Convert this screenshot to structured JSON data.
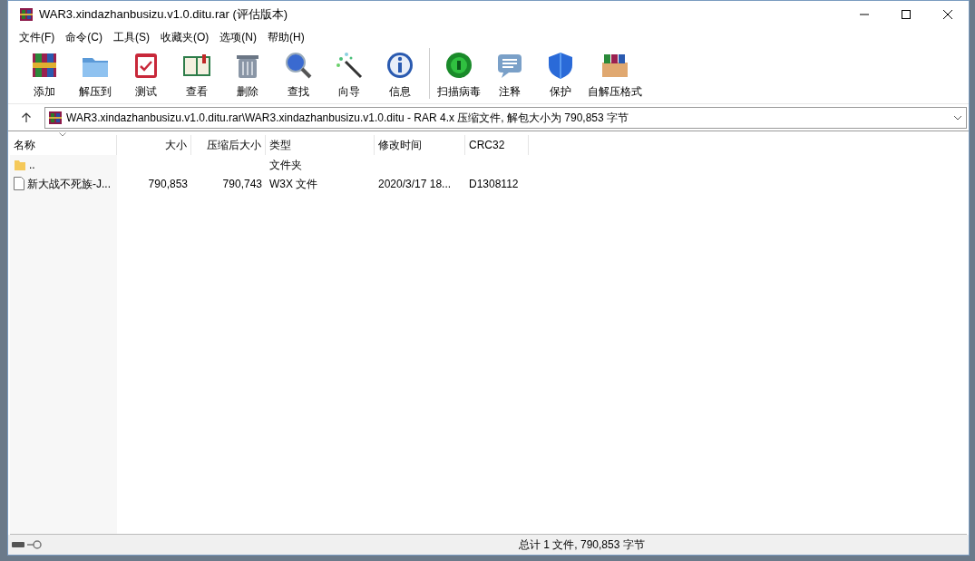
{
  "window": {
    "title": "WAR3.xindazhanbusizu.v1.0.ditu.rar (评估版本)"
  },
  "menu": [
    "文件(F)",
    "命令(C)",
    "工具(S)",
    "收藏夹(O)",
    "选项(N)",
    "帮助(H)"
  ],
  "toolbar": {
    "groups": [
      [
        {
          "kind": "add",
          "label": "添加"
        },
        {
          "kind": "extract",
          "label": "解压到"
        },
        {
          "kind": "test",
          "label": "测试"
        },
        {
          "kind": "view",
          "label": "查看"
        },
        {
          "kind": "delete",
          "label": "删除"
        },
        {
          "kind": "find",
          "label": "查找"
        },
        {
          "kind": "wizard",
          "label": "向导"
        },
        {
          "kind": "info",
          "label": "信息"
        }
      ],
      [
        {
          "kind": "scan",
          "label": "扫描病毒"
        },
        {
          "kind": "comment",
          "label": "注释"
        },
        {
          "kind": "protect",
          "label": "保护"
        },
        {
          "kind": "sfx",
          "label": "自解压格式"
        }
      ]
    ]
  },
  "address": {
    "path": "WAR3.xindazhanbusizu.v1.0.ditu.rar\\WAR3.xindazhanbusizu.v1.0.ditu - RAR 4.x 压缩文件, 解包大小为 790,853 字节"
  },
  "table": {
    "columns": [
      "名称",
      "大小",
      "压缩后大小",
      "类型",
      "修改时间",
      "CRC32"
    ],
    "rows": [
      {
        "kind": "folder",
        "cells": [
          "..",
          "",
          "",
          "文件夹",
          "",
          ""
        ]
      },
      {
        "kind": "file",
        "cells": [
          "新大战不死族-J...",
          "790,853",
          "790,743",
          "W3X 文件",
          "2020/3/17 18...",
          "D1308112"
        ]
      }
    ]
  },
  "status_bar": {
    "text": "总计 1 文件, 790,853 字节"
  }
}
